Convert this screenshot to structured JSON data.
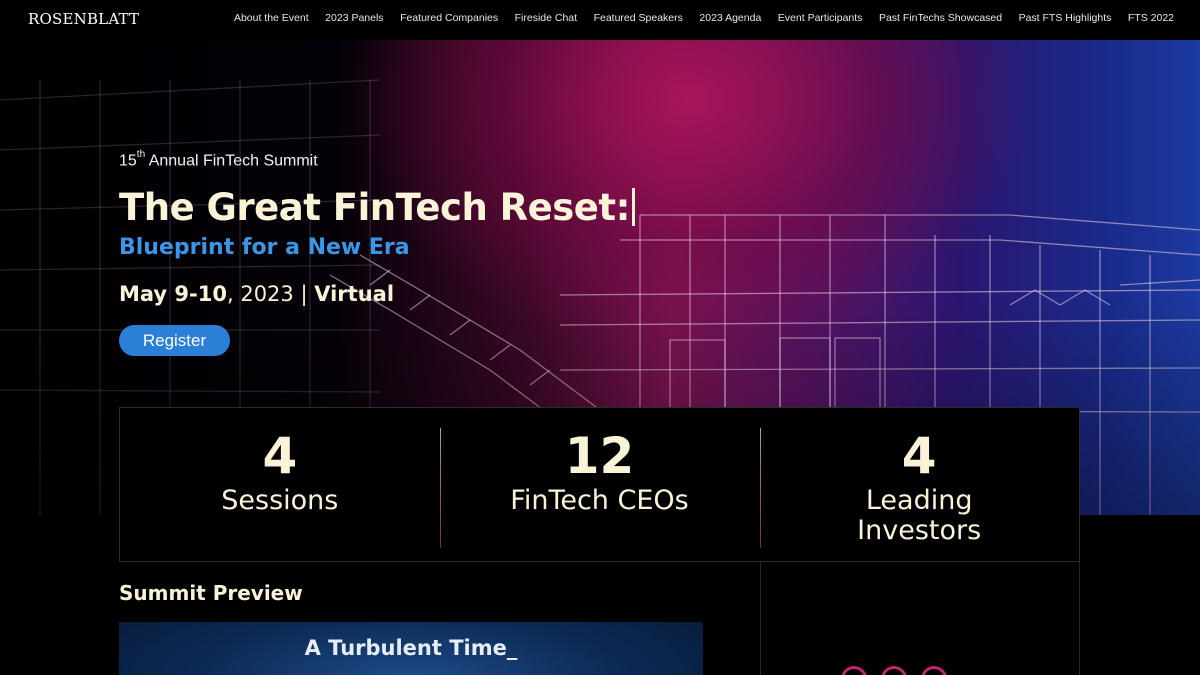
{
  "header": {
    "logo": "ROSENBLATT",
    "nav": [
      "About the Event",
      "2023 Panels",
      "Featured Companies",
      "Fireside Chat",
      "Featured Speakers",
      "2023 Agenda",
      "Event Participants",
      "Past FinTechs Showcased",
      "Past FTS Highlights",
      "FTS 2022"
    ]
  },
  "hero": {
    "eyebrow_num": "15",
    "eyebrow_sup": "th",
    "eyebrow_rest": " Annual FinTech Summit",
    "title": "The Great FinTech Reset:",
    "subtitle": "Blueprint for a New Era",
    "date_bold": "May 9-10",
    "date_year": ", 2023 | ",
    "date_format": "Virtual",
    "register_label": "Register"
  },
  "stats": [
    {
      "number": "4",
      "label": "Sessions"
    },
    {
      "number": "12",
      "label": "FinTech CEOs"
    },
    {
      "number": "4",
      "label": "Leading Investors"
    }
  ],
  "preview": {
    "heading": "Summit Preview",
    "video_title": "A Turbulent Time_"
  },
  "colors": {
    "accent_blue": "#2b7fd6",
    "cream": "#fbf3d8",
    "magenta": "#7a1350"
  }
}
